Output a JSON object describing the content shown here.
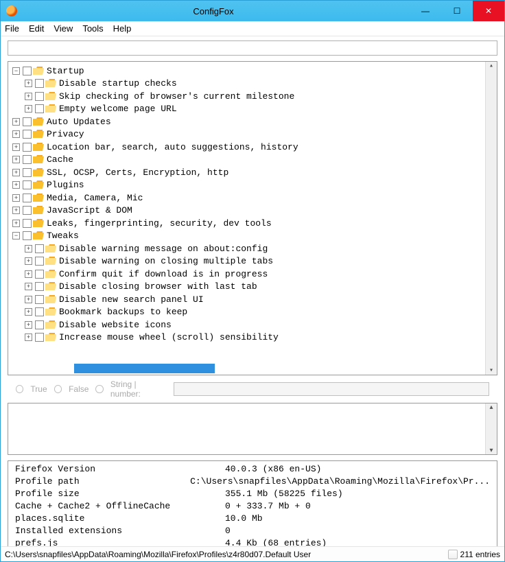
{
  "title": "ConfigFox",
  "menu": [
    "File",
    "Edit",
    "View",
    "Tools",
    "Help"
  ],
  "tree": [
    {
      "d": 0,
      "t": "-",
      "open": true,
      "lbl": "Startup"
    },
    {
      "d": 1,
      "t": "+",
      "open": true,
      "lbl": "Disable startup checks"
    },
    {
      "d": 1,
      "t": "+",
      "open": true,
      "lbl": "Skip checking of browser's current milestone"
    },
    {
      "d": 1,
      "t": "+",
      "open": true,
      "lbl": "Empty welcome page URL"
    },
    {
      "d": 0,
      "t": "+",
      "open": false,
      "lbl": "Auto Updates"
    },
    {
      "d": 0,
      "t": "+",
      "open": false,
      "lbl": "Privacy"
    },
    {
      "d": 0,
      "t": "+",
      "open": false,
      "lbl": "Location bar, search, auto suggestions, history"
    },
    {
      "d": 0,
      "t": "+",
      "open": false,
      "lbl": "Cache"
    },
    {
      "d": 0,
      "t": "+",
      "open": false,
      "lbl": "SSL, OCSP, Certs, Encryption, http"
    },
    {
      "d": 0,
      "t": "+",
      "open": false,
      "lbl": "Plugins"
    },
    {
      "d": 0,
      "t": "+",
      "open": false,
      "lbl": "Media, Camera, Mic"
    },
    {
      "d": 0,
      "t": "+",
      "open": false,
      "lbl": "JavaScript & DOM"
    },
    {
      "d": 0,
      "t": "+",
      "open": false,
      "lbl": "Leaks, fingerprinting, security, dev tools"
    },
    {
      "d": 0,
      "t": "-",
      "open": false,
      "lbl": "Tweaks"
    },
    {
      "d": 1,
      "t": "+",
      "open": true,
      "lbl": "Disable warning message on about:config"
    },
    {
      "d": 1,
      "t": "+",
      "open": true,
      "lbl": "Disable warning on closing multiple tabs"
    },
    {
      "d": 1,
      "t": "+",
      "open": true,
      "lbl": "Confirm quit if download is in progress"
    },
    {
      "d": 1,
      "t": "+",
      "open": true,
      "lbl": "Disable closing browser with last tab"
    },
    {
      "d": 1,
      "t": "+",
      "open": true,
      "lbl": "Disable new search panel UI"
    },
    {
      "d": 1,
      "t": "+",
      "open": true,
      "lbl": "Bookmark backups to keep"
    },
    {
      "d": 1,
      "t": "+",
      "open": true,
      "lbl": "Disable website icons"
    },
    {
      "d": 1,
      "t": "+",
      "open": true,
      "lbl": "Increase mouse wheel (scroll) sensibility"
    }
  ],
  "radios": {
    "true": "True",
    "false": "False",
    "string": "String | number:"
  },
  "info": [
    {
      "k": "Firefox Version",
      "v": "40.0.3 (x86 en-US)"
    },
    {
      "k": "Profile path",
      "v": "C:\\Users\\snapfiles\\AppData\\Roaming\\Mozilla\\Firefox\\Pr..."
    },
    {
      "k": "Profile size",
      "v": "355.1 Mb (58225 files)"
    },
    {
      "k": "Cache + Cache2 + OfflineCache",
      "v": "0 + 333.7 Mb + 0"
    },
    {
      "k": "places.sqlite",
      "v": "10.0 Mb"
    },
    {
      "k": "Installed extensions",
      "v": "0"
    },
    {
      "k": "prefs.js",
      "v": "4.4 Kb (68 entries)"
    }
  ],
  "status": {
    "path": "C:\\Users\\snapfiles\\AppData\\Roaming\\Mozilla\\Firefox\\Profiles\\z4r80d07.Default User",
    "entries": "211 entries"
  }
}
